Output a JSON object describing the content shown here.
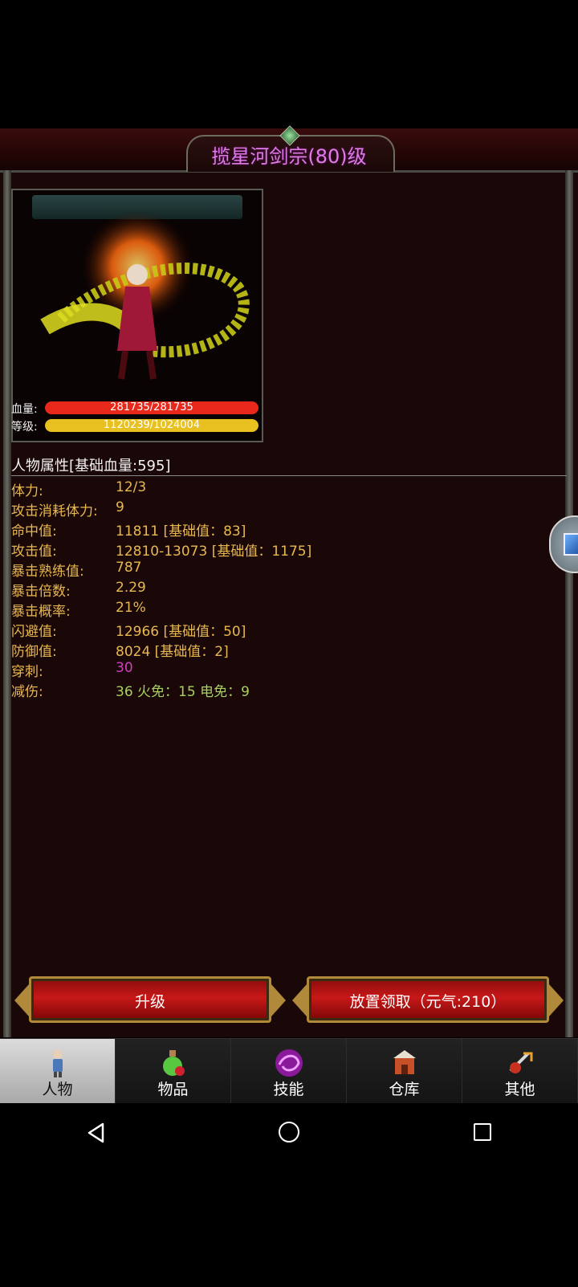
{
  "title": "揽星河剑宗(80)级",
  "stats_bars": {
    "hp": {
      "label": "血量:",
      "text": "281735/281735",
      "fraction": 1.0,
      "color": "#e8281a"
    },
    "level": {
      "label": "等级:",
      "text": "1120239/1024004",
      "fraction": 1.0,
      "color": "#e8c020"
    }
  },
  "section_title": "人物属性[基础血量:595]",
  "attributes": [
    {
      "label": "体力:",
      "value": "12/3"
    },
    {
      "label": "攻击消耗体力:",
      "value": "9"
    },
    {
      "label": "命中值:",
      "value": "11811 [基础值：83]"
    },
    {
      "label": "攻击值:",
      "value": "12810-13073 [基础值：1175]"
    },
    {
      "label": "暴击熟练值:",
      "value": "787"
    },
    {
      "label": "暴击倍数:",
      "value": "2.29"
    },
    {
      "label": "暴击概率:",
      "value": "21%"
    },
    {
      "label": "闪避值:",
      "value": "12966 [基础值：50]"
    },
    {
      "label": "防御值:",
      "value": "8024 [基础值：2]"
    },
    {
      "label": "穿刺:",
      "value": "30"
    },
    {
      "label": "减伤:",
      "value": "36 火免：15 电免：9"
    }
  ],
  "buttons": {
    "upgrade": "升级",
    "idle_reward": "放置领取（元气:210）"
  },
  "tabs": [
    {
      "label": "人物",
      "icon": "character-icon"
    },
    {
      "label": "物品",
      "icon": "potion-icon"
    },
    {
      "label": "技能",
      "icon": "skill-orb-icon"
    },
    {
      "label": "仓库",
      "icon": "warehouse-icon"
    },
    {
      "label": "其他",
      "icon": "other-icon"
    }
  ],
  "colors": {
    "title": "#e07ae8",
    "attr_text": "#e8b850",
    "pierce": "#d040c0",
    "damage_reduction": "#a8d060"
  }
}
